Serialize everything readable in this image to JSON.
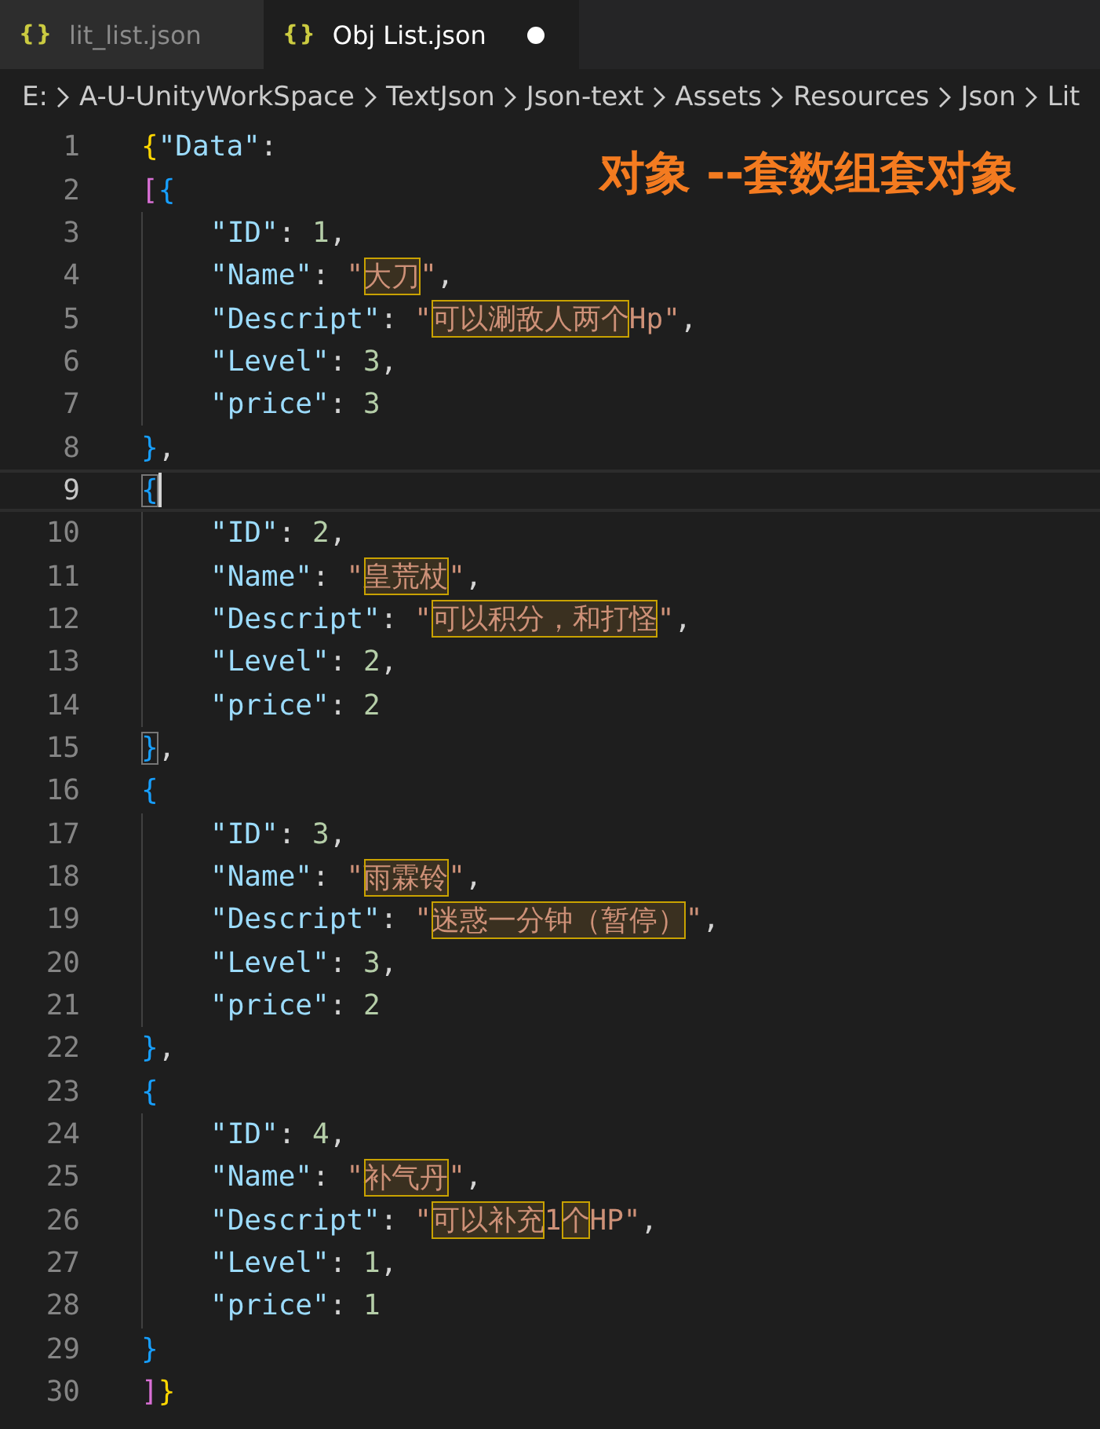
{
  "tabs": [
    {
      "icon": "{}",
      "label": "lit_list.json",
      "selected": false,
      "dirty": false
    },
    {
      "icon": "{}",
      "label": "Obj List.json",
      "selected": true,
      "dirty": true
    }
  ],
  "breadcrumb": [
    "E:",
    "A-U-UnityWorkSpace",
    "TextJson",
    "Json-text",
    "Assets",
    "Resources",
    "Json",
    "Lit"
  ],
  "annotation": "对象 --套数组套对象",
  "lines": [
    {
      "number": "1",
      "indented": false,
      "current": false,
      "tokens": [
        {
          "kind": "bracket",
          "text": "{",
          "color": "#ffd700"
        },
        {
          "kind": "key",
          "text": "\"Data\""
        },
        {
          "kind": "punct",
          "text": ":"
        }
      ]
    },
    {
      "number": "2",
      "indented": false,
      "current": false,
      "tokens": [
        {
          "kind": "bracket",
          "text": "[",
          "color": "#da70d6"
        },
        {
          "kind": "bracket",
          "text": "{",
          "color": "#179fff"
        }
      ]
    },
    {
      "number": "3",
      "indented": true,
      "current": false,
      "tokens": [
        {
          "kind": "key",
          "text": "\"ID\""
        },
        {
          "kind": "punct",
          "text": ": "
        },
        {
          "kind": "number",
          "text": "1"
        },
        {
          "kind": "punct",
          "text": ","
        }
      ]
    },
    {
      "number": "4",
      "indented": true,
      "current": false,
      "tokens": [
        {
          "kind": "key",
          "text": "\"Name\""
        },
        {
          "kind": "punct",
          "text": ": "
        },
        {
          "kind": "string",
          "text": "\""
        },
        {
          "kind": "string",
          "text": "大刀",
          "highlighted": true
        },
        {
          "kind": "string",
          "text": "\""
        },
        {
          "kind": "punct",
          "text": ","
        }
      ]
    },
    {
      "number": "5",
      "indented": true,
      "current": false,
      "tokens": [
        {
          "kind": "key",
          "text": "\"Descript\""
        },
        {
          "kind": "punct",
          "text": ": "
        },
        {
          "kind": "string",
          "text": "\""
        },
        {
          "kind": "string",
          "text": "可以涮敌人两个",
          "highlighted": true
        },
        {
          "kind": "string",
          "text": "Hp\""
        },
        {
          "kind": "punct",
          "text": ","
        }
      ]
    },
    {
      "number": "6",
      "indented": true,
      "current": false,
      "tokens": [
        {
          "kind": "key",
          "text": "\"Level\""
        },
        {
          "kind": "punct",
          "text": ": "
        },
        {
          "kind": "number",
          "text": "3"
        },
        {
          "kind": "punct",
          "text": ","
        }
      ]
    },
    {
      "number": "7",
      "indented": true,
      "current": false,
      "tokens": [
        {
          "kind": "key",
          "text": "\"price\""
        },
        {
          "kind": "punct",
          "text": ": "
        },
        {
          "kind": "number",
          "text": "3"
        }
      ]
    },
    {
      "number": "8",
      "indented": false,
      "current": false,
      "tokens": [
        {
          "kind": "bracket",
          "text": "}",
          "color": "#179fff"
        },
        {
          "kind": "punct",
          "text": ","
        }
      ]
    },
    {
      "number": "9",
      "indented": false,
      "current": true,
      "tokens": [
        {
          "kind": "bracket",
          "text": "{",
          "color": "#179fff",
          "matched": true
        }
      ]
    },
    {
      "number": "10",
      "indented": true,
      "current": false,
      "tokens": [
        {
          "kind": "key",
          "text": "\"ID\""
        },
        {
          "kind": "punct",
          "text": ": "
        },
        {
          "kind": "number",
          "text": "2"
        },
        {
          "kind": "punct",
          "text": ","
        }
      ]
    },
    {
      "number": "11",
      "indented": true,
      "current": false,
      "tokens": [
        {
          "kind": "key",
          "text": "\"Name\""
        },
        {
          "kind": "punct",
          "text": ": "
        },
        {
          "kind": "string",
          "text": "\""
        },
        {
          "kind": "string",
          "text": "皇荒杖",
          "highlighted": true
        },
        {
          "kind": "string",
          "text": "\""
        },
        {
          "kind": "punct",
          "text": ","
        }
      ]
    },
    {
      "number": "12",
      "indented": true,
      "current": false,
      "tokens": [
        {
          "kind": "key",
          "text": "\"Descript\""
        },
        {
          "kind": "punct",
          "text": ": "
        },
        {
          "kind": "string",
          "text": "\""
        },
        {
          "kind": "string",
          "text": "可以积分，和打怪",
          "highlighted": true
        },
        {
          "kind": "string",
          "text": "\""
        },
        {
          "kind": "punct",
          "text": ","
        }
      ]
    },
    {
      "number": "13",
      "indented": true,
      "current": false,
      "tokens": [
        {
          "kind": "key",
          "text": "\"Level\""
        },
        {
          "kind": "punct",
          "text": ": "
        },
        {
          "kind": "number",
          "text": "2"
        },
        {
          "kind": "punct",
          "text": ","
        }
      ]
    },
    {
      "number": "14",
      "indented": true,
      "current": false,
      "tokens": [
        {
          "kind": "key",
          "text": "\"price\""
        },
        {
          "kind": "punct",
          "text": ": "
        },
        {
          "kind": "number",
          "text": "2"
        }
      ]
    },
    {
      "number": "15",
      "indented": false,
      "current": false,
      "tokens": [
        {
          "kind": "bracket",
          "text": "}",
          "color": "#179fff",
          "matched": true
        },
        {
          "kind": "punct",
          "text": ","
        }
      ]
    },
    {
      "number": "16",
      "indented": false,
      "current": false,
      "tokens": [
        {
          "kind": "bracket",
          "text": "{",
          "color": "#179fff"
        }
      ]
    },
    {
      "number": "17",
      "indented": true,
      "current": false,
      "tokens": [
        {
          "kind": "key",
          "text": "\"ID\""
        },
        {
          "kind": "punct",
          "text": ": "
        },
        {
          "kind": "number",
          "text": "3"
        },
        {
          "kind": "punct",
          "text": ","
        }
      ]
    },
    {
      "number": "18",
      "indented": true,
      "current": false,
      "tokens": [
        {
          "kind": "key",
          "text": "\"Name\""
        },
        {
          "kind": "punct",
          "text": ": "
        },
        {
          "kind": "string",
          "text": "\""
        },
        {
          "kind": "string",
          "text": "雨霖铃",
          "highlighted": true
        },
        {
          "kind": "string",
          "text": "\""
        },
        {
          "kind": "punct",
          "text": ","
        }
      ]
    },
    {
      "number": "19",
      "indented": true,
      "current": false,
      "tokens": [
        {
          "kind": "key",
          "text": "\"Descript\""
        },
        {
          "kind": "punct",
          "text": ": "
        },
        {
          "kind": "string",
          "text": "\""
        },
        {
          "kind": "string",
          "text": "迷惑一分钟（暂停）",
          "highlighted": true
        },
        {
          "kind": "string",
          "text": "\""
        },
        {
          "kind": "punct",
          "text": ","
        }
      ]
    },
    {
      "number": "20",
      "indented": true,
      "current": false,
      "tokens": [
        {
          "kind": "key",
          "text": "\"Level\""
        },
        {
          "kind": "punct",
          "text": ": "
        },
        {
          "kind": "number",
          "text": "3"
        },
        {
          "kind": "punct",
          "text": ","
        }
      ]
    },
    {
      "number": "21",
      "indented": true,
      "current": false,
      "tokens": [
        {
          "kind": "key",
          "text": "\"price\""
        },
        {
          "kind": "punct",
          "text": ": "
        },
        {
          "kind": "number",
          "text": "2"
        }
      ]
    },
    {
      "number": "22",
      "indented": false,
      "current": false,
      "tokens": [
        {
          "kind": "bracket",
          "text": "}",
          "color": "#179fff"
        },
        {
          "kind": "punct",
          "text": ","
        }
      ]
    },
    {
      "number": "23",
      "indented": false,
      "current": false,
      "tokens": [
        {
          "kind": "bracket",
          "text": "{",
          "color": "#179fff"
        }
      ]
    },
    {
      "number": "24",
      "indented": true,
      "current": false,
      "tokens": [
        {
          "kind": "key",
          "text": "\"ID\""
        },
        {
          "kind": "punct",
          "text": ": "
        },
        {
          "kind": "number",
          "text": "4"
        },
        {
          "kind": "punct",
          "text": ","
        }
      ]
    },
    {
      "number": "25",
      "indented": true,
      "current": false,
      "tokens": [
        {
          "kind": "key",
          "text": "\"Name\""
        },
        {
          "kind": "punct",
          "text": ": "
        },
        {
          "kind": "string",
          "text": "\""
        },
        {
          "kind": "string",
          "text": "补气丹",
          "highlighted": true
        },
        {
          "kind": "string",
          "text": "\""
        },
        {
          "kind": "punct",
          "text": ","
        }
      ]
    },
    {
      "number": "26",
      "indented": true,
      "current": false,
      "tokens": [
        {
          "kind": "key",
          "text": "\"Descript\""
        },
        {
          "kind": "punct",
          "text": ": "
        },
        {
          "kind": "string",
          "text": "\""
        },
        {
          "kind": "string",
          "text": "可以补充",
          "highlighted": true
        },
        {
          "kind": "string",
          "text": "1"
        },
        {
          "kind": "string",
          "text": "个",
          "highlighted": true
        },
        {
          "kind": "string",
          "text": "HP\""
        },
        {
          "kind": "punct",
          "text": ","
        }
      ]
    },
    {
      "number": "27",
      "indented": true,
      "current": false,
      "tokens": [
        {
          "kind": "key",
          "text": "\"Level\""
        },
        {
          "kind": "punct",
          "text": ": "
        },
        {
          "kind": "number",
          "text": "1"
        },
        {
          "kind": "punct",
          "text": ","
        }
      ]
    },
    {
      "number": "28",
      "indented": true,
      "current": false,
      "tokens": [
        {
          "kind": "key",
          "text": "\"price\""
        },
        {
          "kind": "punct",
          "text": ": "
        },
        {
          "kind": "number",
          "text": "1"
        }
      ]
    },
    {
      "number": "29",
      "indented": false,
      "current": false,
      "tokens": [
        {
          "kind": "bracket",
          "text": "}",
          "color": "#179fff"
        }
      ]
    },
    {
      "number": "30",
      "indented": false,
      "current": false,
      "tokens": [
        {
          "kind": "bracket",
          "text": "]",
          "color": "#da70d6"
        },
        {
          "kind": "bracket",
          "text": "}",
          "color": "#ffd700"
        }
      ]
    }
  ]
}
